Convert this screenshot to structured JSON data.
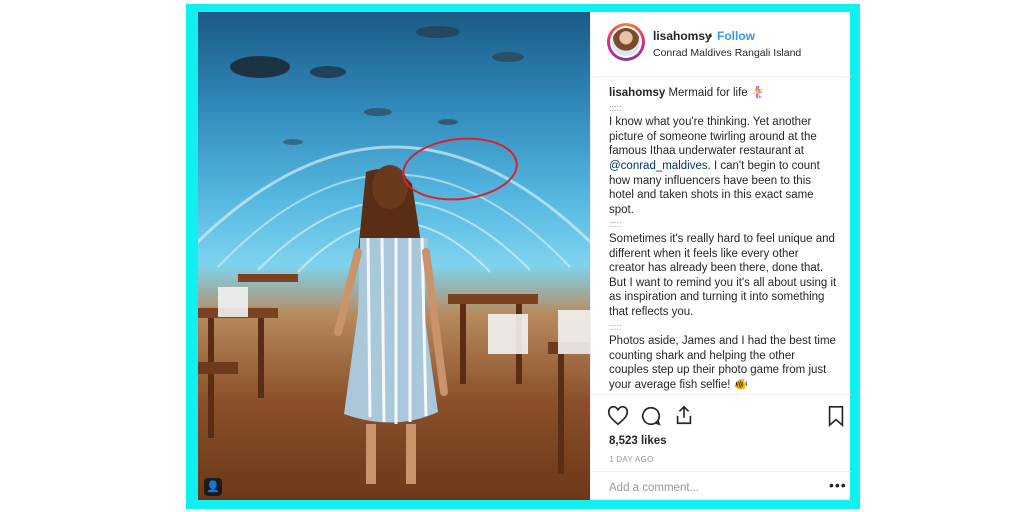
{
  "post": {
    "username": "lisahomsy",
    "separator": "•",
    "follow_label": "Follow",
    "location": "Conrad Maldives Rangali Island",
    "caption": {
      "username": "lisahomsy",
      "first_line": "Mermaid for life",
      "first_line_emoji": "🧜‍♀️",
      "sep1": ":::::",
      "p1_before": "I know what you're thinking. Yet another picture of someone twirling around at the famous Ithaa underwater restaurant at ",
      "mention": "@conrad_maldives",
      "p1_after": ". I can't begin to count how many influencers have been to this hotel and taken shots in this exact same spot.",
      "sep2": ":::::",
      "p2": "Sometimes it's really hard to feel unique and different when it feels like every other creator has already been there, done that. But I want to remind you it's all about using it as inspiration and turning it into something that reflects you.",
      "sep3": ":::::",
      "p3": "Photos aside, James and I had the best time counting shark and helping the other couples step up their photo game from just your average fish selfie!",
      "p3_emoji": "🐠"
    },
    "likes": "8,523 likes",
    "time_ago": "1 DAY AGO",
    "comment_placeholder": "Add a comment...",
    "more_label": "•••"
  },
  "icons": {
    "like": "heart-icon",
    "comment": "comment-icon",
    "share": "share-icon",
    "save": "bookmark-icon",
    "tag": "user-tag-icon"
  },
  "colors": {
    "frame": "#11f0f0",
    "follow": "#3897f0",
    "mention": "#003569",
    "annotation": "#e01e2a"
  }
}
